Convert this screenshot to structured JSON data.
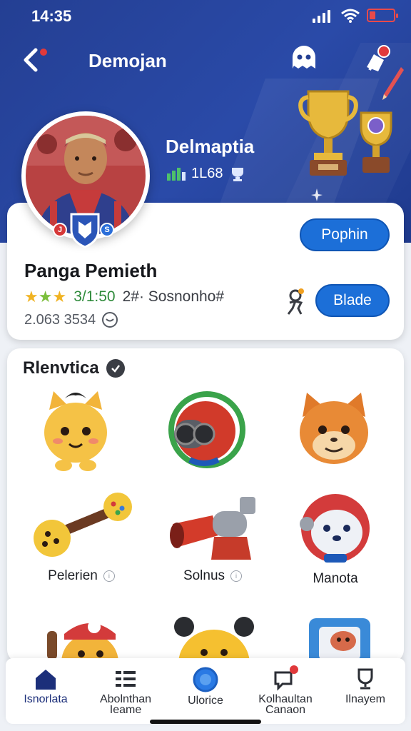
{
  "status_bar": {
    "time": "14:35"
  },
  "header": {
    "title": "Demojan"
  },
  "hero": {
    "name": "Delmaptia",
    "stat_value": "1L68"
  },
  "profile": {
    "badge_left": "J",
    "badge_right": "S",
    "follow_label": "Pophin",
    "player_name": "Panga Pemieth",
    "rating_score": "3/1:50",
    "rating_tag": "2#· Sosnonho#",
    "meta_text": "2.063 3534",
    "trade_label": "Blade",
    "stars_filled": 3
  },
  "collection": {
    "title": "Rlenvtica",
    "items": [
      {
        "icon": "cat-mascot-icon",
        "label": ""
      },
      {
        "icon": "gas-mask-helmet-icon",
        "label": ""
      },
      {
        "icon": "fox-mascot-icon",
        "label": ""
      },
      {
        "icon": "rattle-bone-icon",
        "label": "Pelerien"
      },
      {
        "icon": "cannon-icon",
        "label": "Solnus"
      },
      {
        "icon": "robot-dog-icon",
        "label": "Manota"
      },
      {
        "icon": "cat-cap-icon",
        "label": ""
      },
      {
        "icon": "bear-mascot-icon",
        "label": ""
      },
      {
        "icon": "pet-box-icon",
        "label": ""
      }
    ]
  },
  "tabs": [
    {
      "label": "Isnorlata",
      "icon": "home-icon"
    },
    {
      "label": "Abolnthan Ieame",
      "icon": "list-icon"
    },
    {
      "label": "Ulorice",
      "icon": "circle-icon"
    },
    {
      "label": "Kolhaultan Canaon",
      "icon": "chat-alert-icon"
    },
    {
      "label": "Ilnayem",
      "icon": "trophy-outline-icon"
    }
  ],
  "colors": {
    "header": "#243f93",
    "primary_button": "#1c6fd8",
    "alert": "#e0393b"
  }
}
